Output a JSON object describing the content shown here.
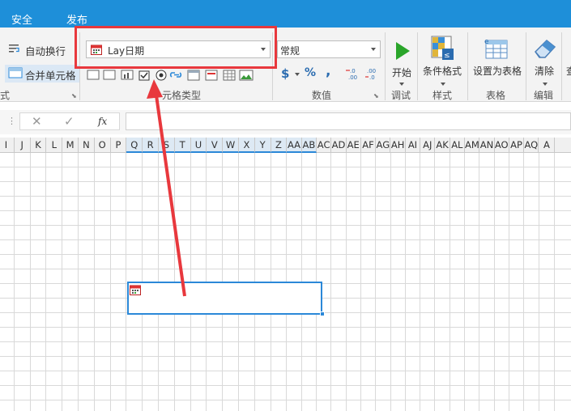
{
  "tabs": [
    "安全",
    "发布"
  ],
  "ribbon": {
    "wrap_text": "自动换行",
    "merge_cells": "合并单元格",
    "align_group_partial": "式",
    "celltype_dropdown": "Lay日期",
    "celltype_group": "元格类型",
    "number_format_dropdown": "常规",
    "number_group": "数值",
    "currency_symbol": "$",
    "percent_symbol": "%",
    "comma_symbol": ",",
    "start_label": "开始",
    "debug_group": "调试",
    "cond_format_label": "条件格式",
    "style_group": "样式",
    "as_table_label": "设置为表格",
    "table_group": "表格",
    "clear_label": "清除",
    "edit_group": "编辑",
    "partial_right": "查"
  },
  "formula_bar": {
    "fx": "fx",
    "cancel": "✕",
    "confirm": "✓"
  },
  "columns": [
    "I",
    "J",
    "K",
    "L",
    "M",
    "N",
    "O",
    "P",
    "Q",
    "R",
    "S",
    "T",
    "U",
    "V",
    "W",
    "X",
    "Y",
    "Z",
    "AA",
    "AB",
    "AC",
    "AD",
    "AE",
    "AF",
    "AG",
    "AH",
    "AI",
    "AJ",
    "AK",
    "AL",
    "AM",
    "AN",
    "AO",
    "AP",
    "AQ",
    "A"
  ],
  "selected_columns": [
    "Q",
    "R",
    "S",
    "T",
    "U",
    "V",
    "W",
    "X",
    "Y",
    "Z",
    "AA",
    "AB"
  ],
  "colors": {
    "accent": "#1e8fd9",
    "highlight": "#e8383d",
    "selection": "#2b88d8",
    "start_green": "#2aa52a"
  }
}
